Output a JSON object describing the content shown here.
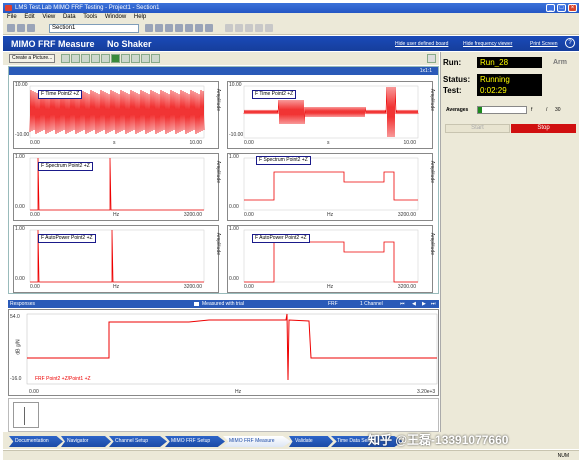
{
  "window": {
    "title": "LMS Test.Lab MIMO FRF Testing - Project1 - Section1"
  },
  "menu": [
    "File",
    "Edit",
    "View",
    "Data",
    "Tools",
    "Window",
    "Help"
  ],
  "toolbar": {
    "section_combo": "Section1"
  },
  "header": {
    "title": "MIMO FRF Measure",
    "subtitle": "No Shaker",
    "links": [
      "Hide user defined board",
      "Hide frequency viewer",
      "Print Screen"
    ]
  },
  "controls": {
    "create_picture": "Create a Picture..."
  },
  "plots_tag": "1x1:1",
  "plots": [
    {
      "legend": "F   Time Point2 +Z",
      "ymax": "10.00",
      "ymin": "-10.00",
      "ylab": "Amplitude",
      "x0": "0.00",
      "xlab": "s",
      "x1": "10.00"
    },
    {
      "legend": "F   Time Point2 +Z",
      "ymax": "10.00",
      "ymin": "-10.00",
      "ylab": "Amplitude",
      "x0": "0.00",
      "xlab": "s",
      "x1": "10.00"
    },
    {
      "legend": "F   Spectrum Point2 +Z",
      "ymax": "1.00",
      "ymin": "0.00",
      "ylab": "Amplitude",
      "x0": "0.00",
      "xlab": "Hz",
      "x1": "3200.00"
    },
    {
      "legend": "F   Spectrum Point2 +Z",
      "ymax": "1.00",
      "ymin": "0.00",
      "ylab": "Amplitude",
      "x0": "0.00",
      "xlab": "Hz",
      "x1": "3200.00"
    },
    {
      "legend": "F   AutoPower Point2 +Z",
      "ymax": "1.00",
      "ymin": "0.00",
      "ylab": "Amplitude",
      "x0": "0.00",
      "xlab": "Hz",
      "x1": "3200.00"
    },
    {
      "legend": "F   AutoPower Point2 +Z",
      "ymax": "1.00",
      "ymin": "0.00",
      "ylab": "Amplitude",
      "x0": "0.00",
      "xlab": "Hz",
      "x1": "3200.00"
    }
  ],
  "side": {
    "run_label": "Run:",
    "run_value": "Run_28",
    "arm": "Arm",
    "status_label": "Status:",
    "status_value": "Running",
    "test_label": "Test:",
    "test_value": "0:02:29",
    "averages_label": "Averages",
    "averages_unit": "f",
    "averages_total": "30",
    "start": "Start",
    "stop": "Stop",
    "status_color": "#ffff00",
    "stop_color": "#d01010"
  },
  "responses": {
    "title": "Responses",
    "option": "Measured with trial",
    "frf": "FRF",
    "channel": "1 Channel",
    "ymax": "54.0",
    "ymin": "-16.0",
    "ylab": "dB g/N",
    "x0": "0.00",
    "xlab": "Hz",
    "x1": "3.20e+3",
    "legend": "FRF Point2 +Z/Point1 +Z"
  },
  "tabs": [
    "Documentation",
    "Navigator",
    "Channel Setup",
    "MIMO FRF Setup",
    "MIMO FRF Measure",
    "Validate",
    "Time Data Select"
  ],
  "active_tab": "MIMO FRF Measure",
  "statusbar": {
    "num": "NUM"
  },
  "watermark": "知乎 @王磊-13391077660"
}
